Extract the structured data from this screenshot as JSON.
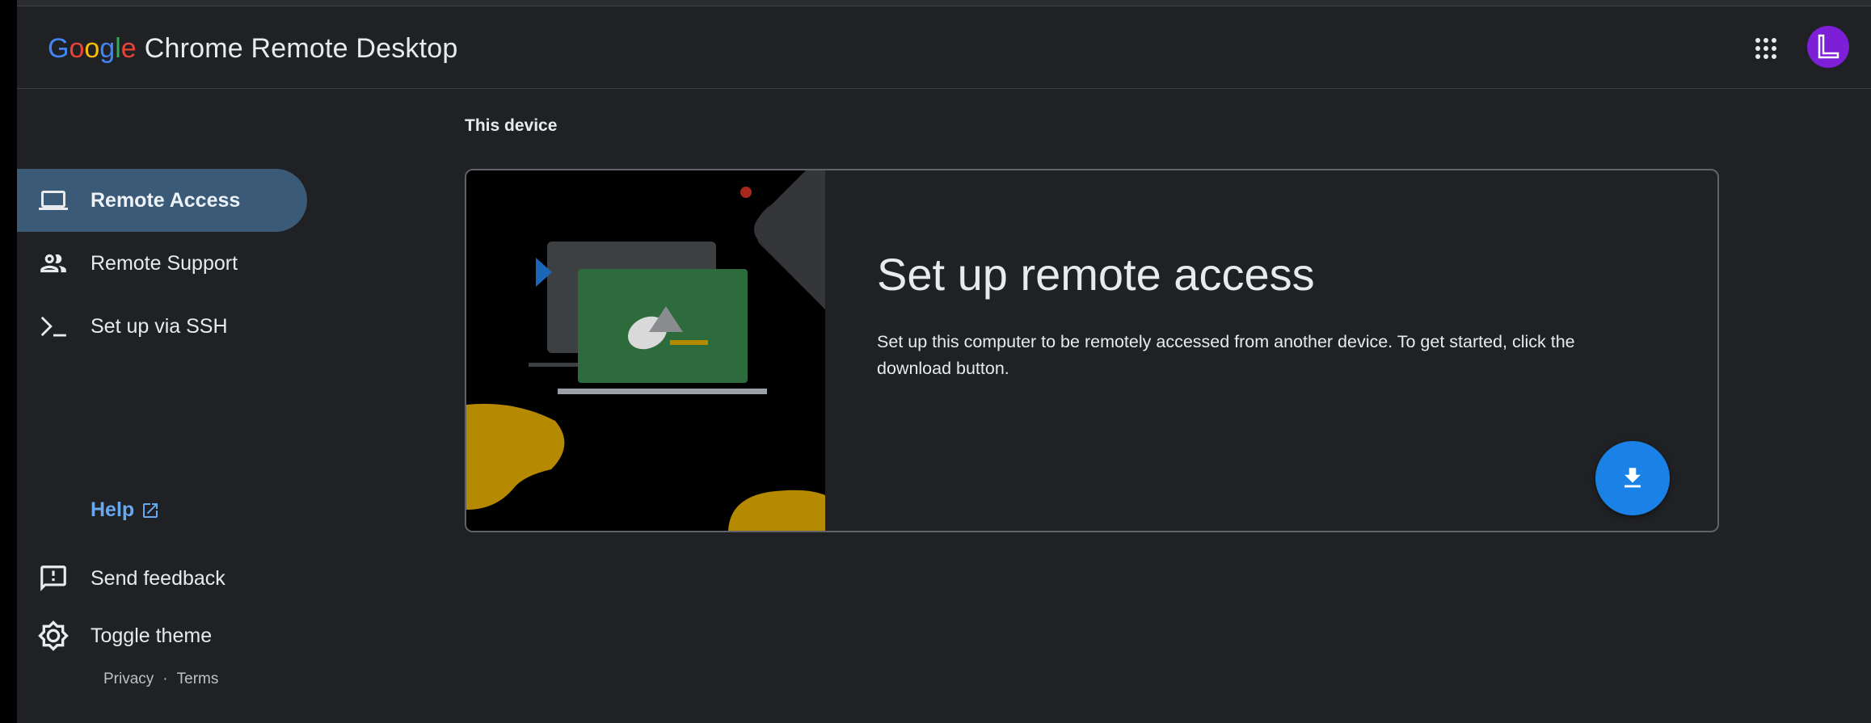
{
  "header": {
    "brand_google_letters": [
      "G",
      "o",
      "o",
      "g",
      "l",
      "e"
    ],
    "brand_google_colors": [
      "#4285f4",
      "#ea4335",
      "#fbbc04",
      "#4285f4",
      "#34a853",
      "#ea4335"
    ],
    "product_name": "Chrome Remote Desktop",
    "apps_icon": "google-apps-grid-icon",
    "avatar_color": "#7c1fd6"
  },
  "sidebar": {
    "items": [
      {
        "label": "Remote Access",
        "icon": "laptop-icon",
        "active": true
      },
      {
        "label": "Remote Support",
        "icon": "people-icon",
        "active": false
      },
      {
        "label": "Set up via SSH",
        "icon": "terminal-prompt-icon",
        "active": false
      }
    ],
    "help_label": "Help",
    "help_icon": "open-in-new-icon",
    "feedback_label": "Send feedback",
    "feedback_icon": "feedback-icon",
    "theme_label": "Toggle theme",
    "theme_icon": "brightness-icon",
    "footer": {
      "privacy": "Privacy",
      "separator": "·",
      "terms": "Terms"
    }
  },
  "main": {
    "section_title": "This device",
    "card": {
      "title": "Set up remote access",
      "description": "Set up this computer to be remotely accessed from another device. To get started, click the download button.",
      "download_icon": "download-icon"
    }
  },
  "colors": {
    "background": "#202124",
    "active_nav": "#3a5a78",
    "link": "#67a9f1",
    "fab": "#1a82e6",
    "illustration_yellow": "#b58900",
    "illustration_green": "#2e6b3c"
  }
}
